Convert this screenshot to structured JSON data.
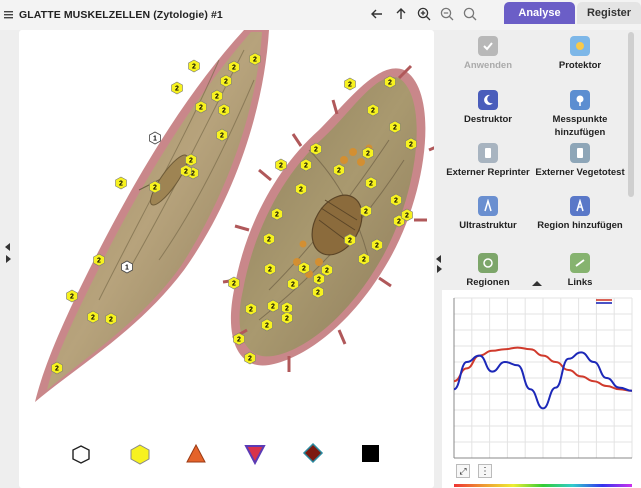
{
  "window": {
    "title": "GLATTE MUSKELZELLEN (Zytologie) #1"
  },
  "tabs": [
    {
      "label": "Analyse",
      "active": true
    },
    {
      "label": "Register",
      "active": false
    }
  ],
  "toolbar": {
    "icons": [
      "arrow-left-icon",
      "arrow-up-icon",
      "zoom-in-icon",
      "zoom-out-icon",
      "search-icon"
    ]
  },
  "tools": [
    {
      "label": "Anwenden",
      "icon": "check-icon",
      "enabled": false
    },
    {
      "label": "Protektor",
      "icon": "protector-icon",
      "enabled": true
    },
    {
      "label": "Destruktor",
      "icon": "destructor-icon",
      "enabled": true
    },
    {
      "label": "Messpunkte hinzufügen",
      "icon": "add-measure-point-icon",
      "enabled": true
    },
    {
      "label": "Externer Reprinter",
      "icon": "reprinter-icon",
      "enabled": true
    },
    {
      "label": "Externer Vegetotest",
      "icon": "vegetotest-icon",
      "enabled": true
    },
    {
      "label": "Ultrastruktur",
      "icon": "ultrastructure-icon",
      "enabled": true
    },
    {
      "label": "Region hinzufügen",
      "icon": "add-region-icon",
      "enabled": true
    },
    {
      "label": "Regionen",
      "icon": "regions-icon",
      "enabled": true
    },
    {
      "label": "Links",
      "icon": "links-icon",
      "enabled": true
    }
  ],
  "image": {
    "marker_labels": {
      "hex_white": "1",
      "hex_yellow": "2"
    }
  },
  "legend_shapes": [
    "white-hexagon",
    "yellow-hexagon",
    "orange-triangle",
    "purple-inverted-triangle",
    "dark-red-diamond",
    "black-square"
  ],
  "colors": {
    "accent": "#6b5ec7",
    "series_red": "#d03a2c",
    "series_blue": "#1c28b8"
  },
  "chart_data": {
    "type": "line",
    "series": [
      {
        "color": "#d03a2c",
        "values": [
          0.48,
          0.56,
          0.64,
          0.67,
          0.68,
          0.69,
          0.68,
          0.64,
          0.6,
          0.55,
          0.51,
          0.48,
          0.45,
          0.43,
          0.42
        ]
      },
      {
        "color": "#1c28b8",
        "values": [
          0.43,
          0.6,
          0.64,
          0.54,
          0.6,
          0.58,
          0.43,
          0.31,
          0.44,
          0.62,
          0.66,
          0.6,
          0.5,
          0.44,
          0.42
        ]
      }
    ],
    "grid": true,
    "legend": "top-right"
  }
}
